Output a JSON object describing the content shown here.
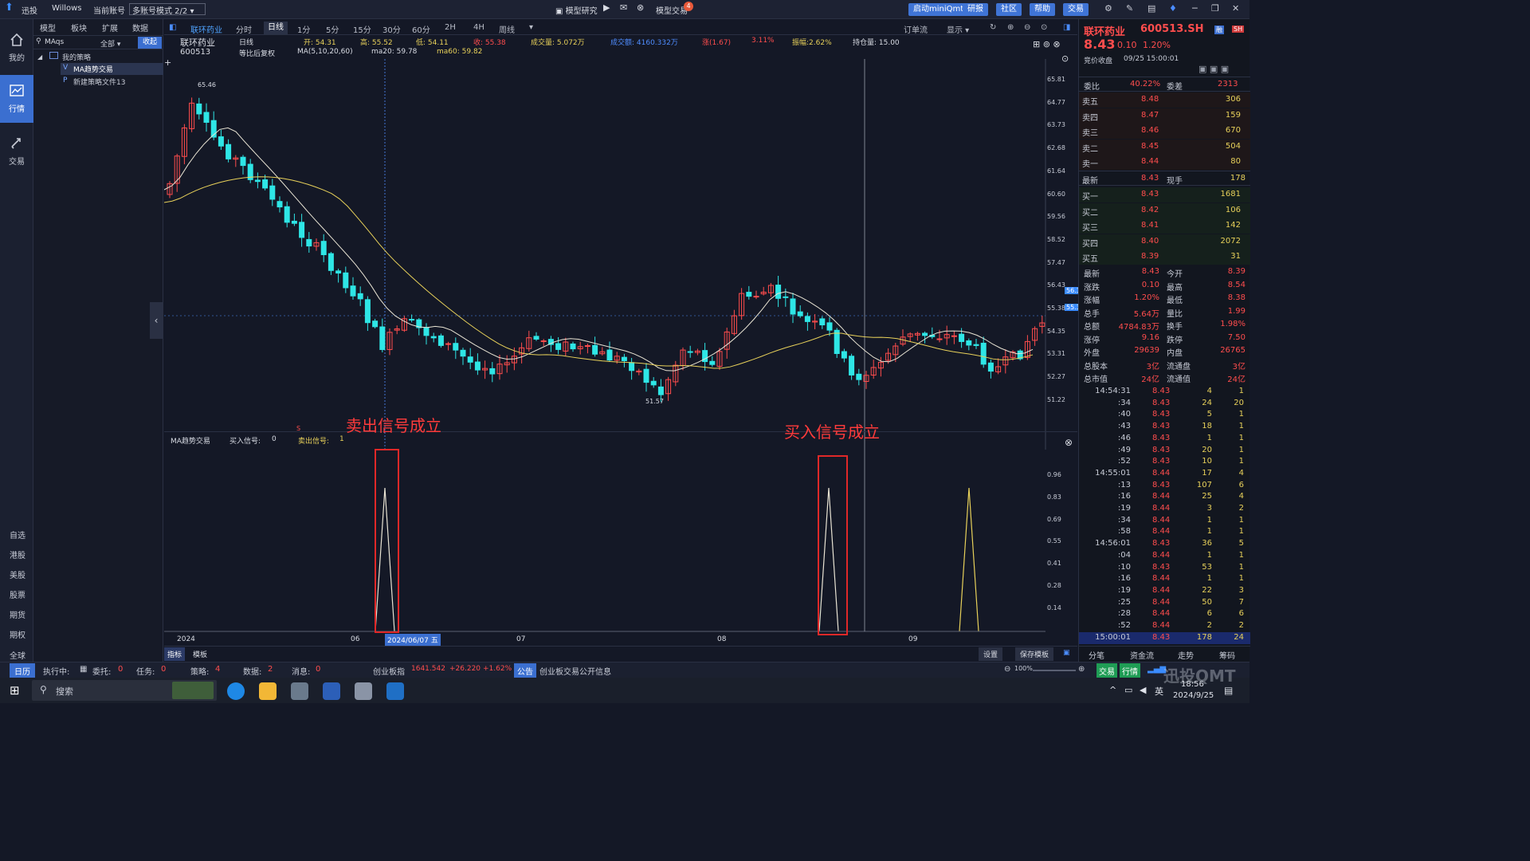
{
  "titlebar": {
    "app_name": "迅投",
    "user": "Willows",
    "account_label": "当前账号",
    "account_mode": "多账号模式 2/2",
    "center_tab1": "模型研究",
    "center_tab2": "模型交易",
    "center_badge": "4",
    "btn_minqmt": "启动miniQmt",
    "btn_research": "研报",
    "btn_community": "社区",
    "btn_help": "帮助",
    "btn_trade": "交易"
  },
  "leftnav": {
    "items": [
      {
        "label": "我的"
      },
      {
        "label": "行情"
      },
      {
        "label": "交易"
      }
    ],
    "links": [
      "自选",
      "港股",
      "美股",
      "股票",
      "期货",
      "期权",
      "全球"
    ]
  },
  "strategy_panel": {
    "menu": [
      "模型",
      "板块",
      "扩展",
      "数据"
    ],
    "search_value": "MAqs",
    "filter": "全部",
    "collapse": "收起",
    "tree": {
      "folder": "我的策略",
      "items": [
        {
          "label": "MA趋势交易",
          "type": "V"
        },
        {
          "label": "新建策略文件13",
          "type": "P"
        }
      ]
    }
  },
  "chart_tabs": {
    "tabs": [
      "联环药业",
      "分时",
      "日线",
      "1分",
      "5分",
      "15分",
      "30分",
      "60分",
      "2H",
      "4H",
      "周线"
    ],
    "right": [
      "订单流",
      "显示"
    ]
  },
  "chart_info": {
    "name": "联环药业",
    "code": "600513",
    "period": "日线",
    "adjust": "等比后复权",
    "open": "开: 54.31",
    "high": "高: 55.52",
    "low": "低: 54.11",
    "close": "收: 55.38",
    "volume": "成交量: 5.072万",
    "amount": "成交额: 4160.332万",
    "change": "涨(1.67)",
    "change_pct": "3.11%",
    "amplitude": "振幅:2.62%",
    "position": "持仓量: 15.00",
    "ma_label": "MA(5,10,20,60)",
    "ma20": "ma20: 59.78",
    "ma60": "ma60: 59.82"
  },
  "price_axis": [
    "65.81",
    "64.77",
    "63.73",
    "62.68",
    "61.64",
    "60.60",
    "59.56",
    "58.52",
    "57.47",
    "56.43",
    "55.38",
    "54.35",
    "53.31",
    "52.27",
    "51.22"
  ],
  "price_tags": {
    "current": "56.39",
    "crosshair": "55.38",
    "high_label": "65.46",
    "low_label": "51.57"
  },
  "indicator": {
    "name": "MA趋势交易",
    "buy_label": "买入信号:",
    "buy_value": "0",
    "sell_label": "卖出信号:",
    "sell_value": "1",
    "axis": [
      "0.96",
      "0.83",
      "0.69",
      "0.55",
      "0.41",
      "0.28",
      "0.14"
    ],
    "marker": "S"
  },
  "annotations": {
    "sell": "卖出信号成立",
    "buy": "买入信号成立"
  },
  "time_axis": {
    "labels": [
      "2024",
      "06",
      "07",
      "08",
      "09"
    ],
    "crosshair_date": "2024/06/07 五"
  },
  "chart_bottom": {
    "tab1": "指标",
    "tab2": "模板",
    "settings": "设置",
    "save": "保存模板"
  },
  "quote": {
    "name": "联环药业",
    "code": "600513.SH",
    "price": "8.43",
    "change": "0.10",
    "change_pct": "1.20%",
    "status": "竞价收盘",
    "time": "09/25 15:00:01",
    "weibi_label": "委比",
    "weibi": "40.22%",
    "weicha_label": "委差",
    "weicha": "2313",
    "asks": [
      {
        "label": "卖五",
        "price": "8.48",
        "vol": "306"
      },
      {
        "label": "卖四",
        "price": "8.47",
        "vol": "159"
      },
      {
        "label": "卖三",
        "price": "8.46",
        "vol": "670"
      },
      {
        "label": "卖二",
        "price": "8.45",
        "vol": "504"
      },
      {
        "label": "卖一",
        "price": "8.44",
        "vol": "80"
      }
    ],
    "latest": {
      "label": "最新",
      "price": "8.43",
      "hand_label": "现手",
      "hand": "178"
    },
    "bids": [
      {
        "label": "买一",
        "price": "8.43",
        "vol": "1681"
      },
      {
        "label": "买二",
        "price": "8.42",
        "vol": "106"
      },
      {
        "label": "买三",
        "price": "8.41",
        "vol": "142"
      },
      {
        "label": "买四",
        "price": "8.40",
        "vol": "2072"
      },
      {
        "label": "买五",
        "price": "8.39",
        "vol": "31"
      }
    ],
    "stats": [
      [
        "最新",
        "8.43",
        "今开",
        "8.39"
      ],
      [
        "涨跌",
        "0.10",
        "最高",
        "8.54"
      ],
      [
        "涨幅",
        "1.20%",
        "最低",
        "8.38"
      ],
      [
        "总手",
        "5.64万",
        "量比",
        "1.99"
      ],
      [
        "总额",
        "4784.83万",
        "换手",
        "1.98%"
      ],
      [
        "涨停",
        "9.16",
        "跌停",
        "7.50"
      ],
      [
        "外盘",
        "29639",
        "内盘",
        "26765"
      ],
      [
        "总股本",
        "3亿",
        "流通盘",
        "3亿"
      ],
      [
        "总市值",
        "24亿",
        "流通值",
        "24亿"
      ]
    ],
    "ticks": [
      [
        "14:54:31",
        "8.43",
        "4",
        "1"
      ],
      [
        ":34",
        "8.43",
        "24",
        "20"
      ],
      [
        ":40",
        "8.43",
        "5",
        "1"
      ],
      [
        ":43",
        "8.43",
        "18",
        "1"
      ],
      [
        ":46",
        "8.43",
        "1",
        "1"
      ],
      [
        ":49",
        "8.43",
        "20",
        "1"
      ],
      [
        ":52",
        "8.43",
        "10",
        "1"
      ],
      [
        "14:55:01",
        "8.44",
        "17",
        "4"
      ],
      [
        ":13",
        "8.43",
        "107",
        "6"
      ],
      [
        ":16",
        "8.44",
        "25",
        "4"
      ],
      [
        ":19",
        "8.44",
        "3",
        "2"
      ],
      [
        ":34",
        "8.44",
        "1",
        "1"
      ],
      [
        ":58",
        "8.44",
        "1",
        "1"
      ],
      [
        "14:56:01",
        "8.43",
        "36",
        "5"
      ],
      [
        ":04",
        "8.44",
        "1",
        "1"
      ],
      [
        ":10",
        "8.43",
        "53",
        "1"
      ],
      [
        ":16",
        "8.44",
        "1",
        "1"
      ],
      [
        ":19",
        "8.44",
        "22",
        "3"
      ],
      [
        ":25",
        "8.44",
        "50",
        "7"
      ],
      [
        ":28",
        "8.44",
        "6",
        "6"
      ],
      [
        ":52",
        "8.44",
        "2",
        "2"
      ],
      [
        "15:00:01",
        "8.43",
        "178",
        "24"
      ]
    ],
    "bottom_tabs": [
      "分笔",
      "资金流",
      "走势",
      "筹码"
    ]
  },
  "statusbar": {
    "calendar": "日历",
    "executing": "执行中:",
    "entrust": "委托:",
    "entrust_v": "0",
    "task": "任务:",
    "task_v": "0",
    "strategy": "策略:",
    "strategy_v": "4",
    "data": "数据:",
    "data_v": "2",
    "msg": "消息:",
    "msg_v": "0",
    "index_name": "创业板指",
    "index_val": "1641.542",
    "index_chg": "+26.220",
    "index_pct": "+1.62%",
    "notice_tag": "公告",
    "notice": "创业板交易公开信息",
    "zoom": "100%",
    "trade": "交易",
    "quote": "行情"
  },
  "taskbar": {
    "search": "搜索",
    "time": "18:56",
    "date": "2024/9/25",
    "ime": "英"
  },
  "watermark": "迅投QMT"
}
